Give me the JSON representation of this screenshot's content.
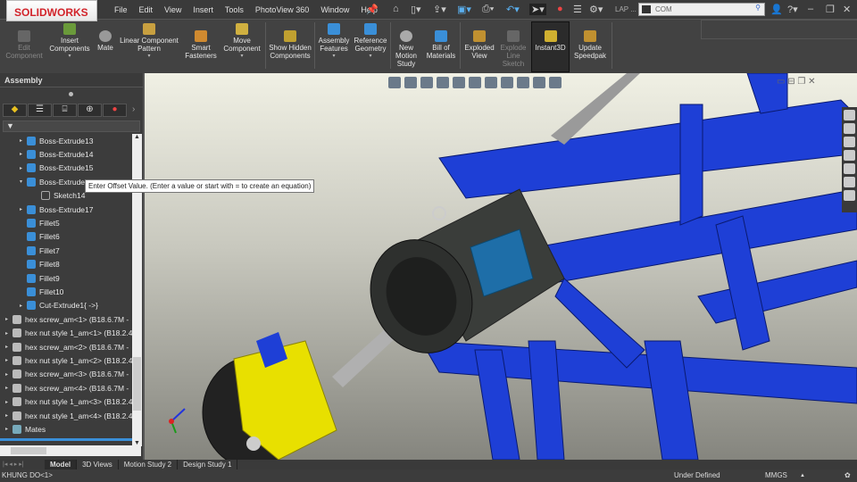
{
  "app": {
    "logo": "SOLIDWORKS",
    "search_value": "COM",
    "user_label": "LAP ..."
  },
  "menu": [
    "File",
    "Edit",
    "View",
    "Insert",
    "Tools",
    "PhotoView 360",
    "Window",
    "Help"
  ],
  "ribbon": [
    {
      "label": "Edit Component",
      "disabled": true
    },
    {
      "label": "Insert Components",
      "dropdown": true
    },
    {
      "label": "Mate"
    },
    {
      "label": "Linear Component Pattern",
      "dropdown": true
    },
    {
      "label": "Smart Fasteners"
    },
    {
      "label": "Move Component",
      "dropdown": true
    },
    {
      "label": "Show Hidden Components"
    },
    {
      "label": "Assembly Features",
      "dropdown": true
    },
    {
      "label": "Reference Geometry",
      "dropdown": true
    },
    {
      "label": "New Motion Study"
    },
    {
      "label": "Bill of Materials"
    },
    {
      "label": "Exploded View"
    },
    {
      "label": "Explode Line Sketch",
      "disabled": true
    },
    {
      "label": "Instant3D",
      "active": true
    },
    {
      "label": "Update Speedpak"
    }
  ],
  "panel_tab": "Assembly",
  "tree": [
    {
      "label": "Boss-Extrude13",
      "indent": 1,
      "arrow": "▸"
    },
    {
      "label": "Boss-Extrude14",
      "indent": 1,
      "arrow": "▸"
    },
    {
      "label": "Boss-Extrude15",
      "indent": 1,
      "arrow": "▸"
    },
    {
      "label": "Boss-Extrude16",
      "indent": 1,
      "arrow": "▾"
    },
    {
      "label": "Sketch14",
      "indent": 2,
      "arrow": ""
    },
    {
      "label": "Boss-Extrude17",
      "indent": 1,
      "arrow": "▸"
    },
    {
      "label": "Fillet5",
      "indent": 1,
      "arrow": ""
    },
    {
      "label": "Fillet6",
      "indent": 1,
      "arrow": ""
    },
    {
      "label": "Fillet7",
      "indent": 1,
      "arrow": ""
    },
    {
      "label": "Fillet8",
      "indent": 1,
      "arrow": ""
    },
    {
      "label": "Fillet9",
      "indent": 1,
      "arrow": ""
    },
    {
      "label": "Fillet10",
      "indent": 1,
      "arrow": ""
    },
    {
      "label": "Cut-Extrude1{ ->}",
      "indent": 1,
      "arrow": "▸"
    },
    {
      "label": "hex screw_am<1> (B18.6.7M -",
      "indent": 0,
      "arrow": "▸"
    },
    {
      "label": "hex nut style 1_am<1> (B18.2.4",
      "indent": 0,
      "arrow": "▸"
    },
    {
      "label": "hex screw_am<2> (B18.6.7M -",
      "indent": 0,
      "arrow": "▸"
    },
    {
      "label": "hex nut style 1_am<2> (B18.2.4",
      "indent": 0,
      "arrow": "▸"
    },
    {
      "label": "hex screw_am<3> (B18.6.7M -",
      "indent": 0,
      "arrow": "▸"
    },
    {
      "label": "hex screw_am<4> (B18.6.7M -",
      "indent": 0,
      "arrow": "▸"
    },
    {
      "label": "hex nut style 1_am<3> (B18.2.4",
      "indent": 0,
      "arrow": "▸"
    },
    {
      "label": "hex nut style 1_am<4> (B18.2.4",
      "indent": 0,
      "arrow": "▸"
    },
    {
      "label": "Mates",
      "indent": 0,
      "arrow": "▸"
    }
  ],
  "tooltip": "Enter Offset Value. (Enter a value or start with = to create an equation)",
  "bottom_tabs": [
    "Model",
    "3D Views",
    "Motion Study 2",
    "Design Study 1"
  ],
  "status": {
    "left": "KHUNG DO<1>",
    "state": "Under Defined",
    "units": "MMGS"
  },
  "colors": {
    "frame": "#1e3fd6",
    "caliper": "#e8e000",
    "motor": "#3a3d3a",
    "accent": "#3a8fd8"
  }
}
